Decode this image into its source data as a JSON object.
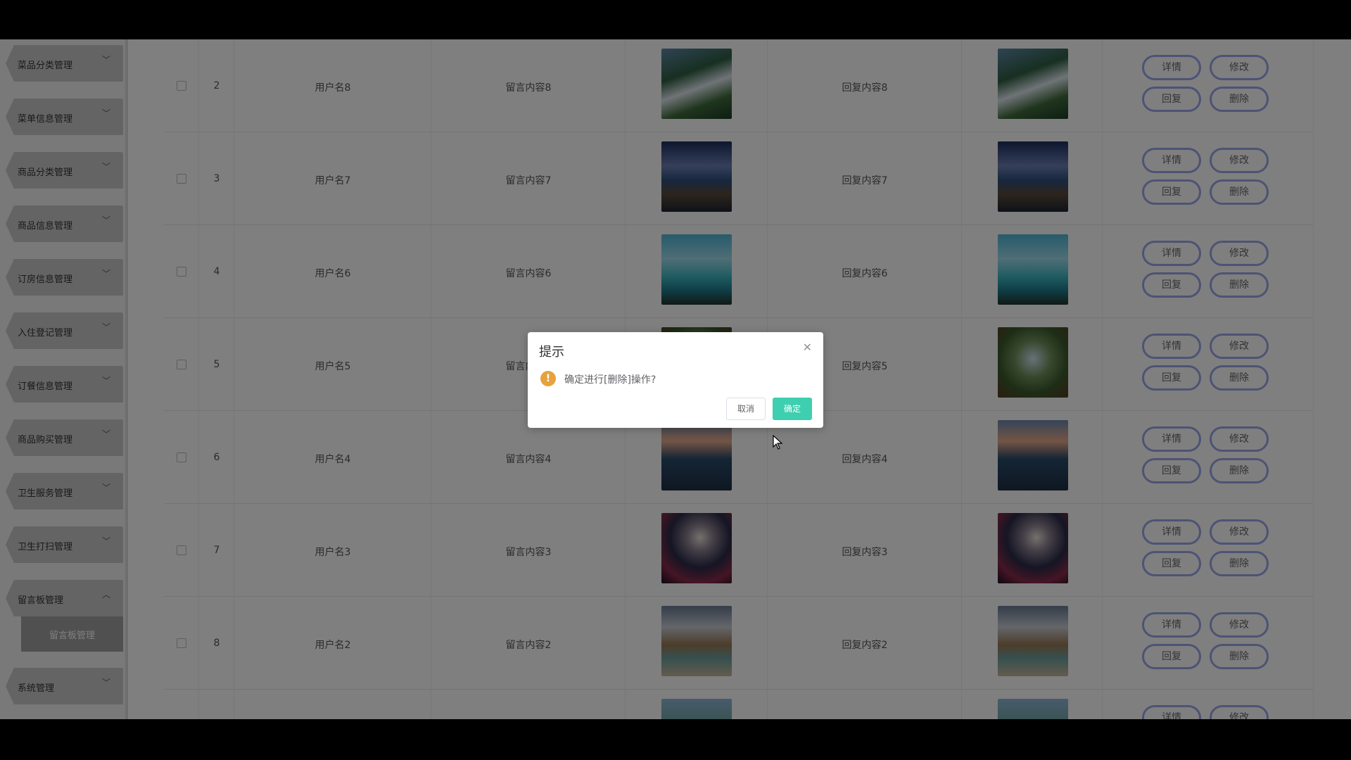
{
  "sidebar": {
    "items": [
      {
        "label": "菜品分类管理",
        "chevron": "chevron-down-icon"
      },
      {
        "label": "菜单信息管理",
        "chevron": "chevron-down-icon"
      },
      {
        "label": "商品分类管理",
        "chevron": "chevron-down-icon"
      },
      {
        "label": "商品信息管理",
        "chevron": "chevron-down-icon"
      },
      {
        "label": "订房信息管理",
        "chevron": "chevron-down-icon"
      },
      {
        "label": "入住登记管理",
        "chevron": "chevron-down-icon"
      },
      {
        "label": "订餐信息管理",
        "chevron": "chevron-down-icon"
      },
      {
        "label": "商品购买管理",
        "chevron": "chevron-down-icon"
      },
      {
        "label": "卫生服务管理",
        "chevron": "chevron-down-icon"
      },
      {
        "label": "卫生打扫管理",
        "chevron": "chevron-down-icon"
      },
      {
        "label": "留言板管理",
        "chevron": "chevron-up-icon"
      },
      {
        "label": "系统管理",
        "chevron": "chevron-down-icon"
      }
    ],
    "sub_item": {
      "label": "留言板管理"
    }
  },
  "table": {
    "rows": [
      {
        "index": "2",
        "username": "用户名8",
        "content": "留言内容8",
        "reply": "回复内容8",
        "image": "waterfall"
      },
      {
        "index": "3",
        "username": "用户名7",
        "content": "留言内容7",
        "reply": "回复内容7",
        "image": "rocky-sea"
      },
      {
        "index": "4",
        "username": "用户名6",
        "content": "留言内容6",
        "reply": "回复内容6",
        "image": "beach-hut"
      },
      {
        "index": "5",
        "username": "用户名5",
        "content": "留言内容5",
        "reply": "回复内容5",
        "image": "forest-canopy"
      },
      {
        "index": "6",
        "username": "用户名4",
        "content": "留言内容4",
        "reply": "回复内容4",
        "image": "mountain-lake"
      },
      {
        "index": "7",
        "username": "用户名3",
        "content": "留言内容3",
        "reply": "回复内容3",
        "image": "moon-tree"
      },
      {
        "index": "8",
        "username": "用户名2",
        "content": "留言内容2",
        "reply": "回复内容2",
        "image": "rock-arch"
      },
      {
        "index": "",
        "username": "",
        "content": "",
        "reply": "",
        "image": "palm-trees"
      }
    ],
    "actions": {
      "detail": "详情",
      "edit": "修改",
      "reply": "回复",
      "delete": "删除"
    }
  },
  "dialog": {
    "title": "提示",
    "message": "确定进行[删除]操作?",
    "cancel_label": "取消",
    "confirm_label": "确定",
    "close_icon": "close-icon",
    "warning_icon": "warning-icon"
  },
  "colors": {
    "confirm": "#3dcfb0",
    "warning": "#e6a23c",
    "action_border": "#9aa6e8"
  }
}
